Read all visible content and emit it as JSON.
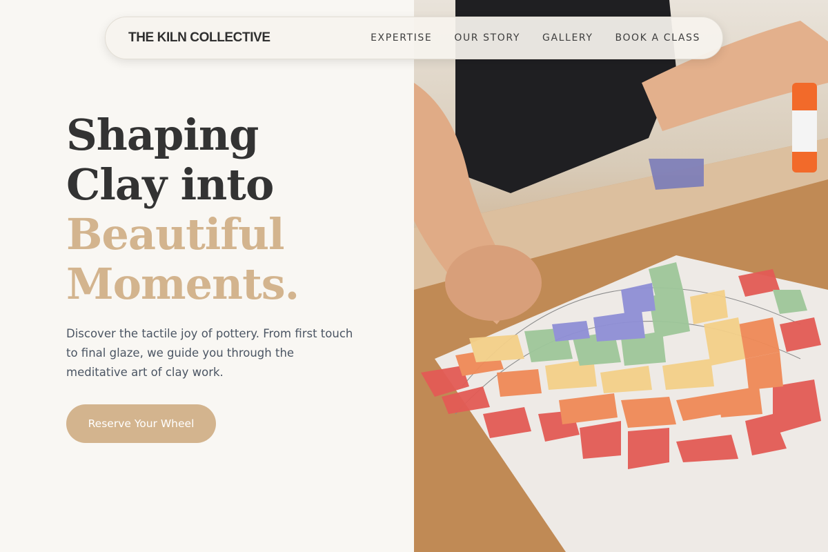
{
  "nav": {
    "brand": "THE KILN COLLECTIVE",
    "links": [
      {
        "label": "EXPERTISE"
      },
      {
        "label": "OUR STORY"
      },
      {
        "label": "GALLERY"
      },
      {
        "label": "BOOK A CLASS"
      }
    ]
  },
  "hero": {
    "headline_line1": "Shaping",
    "headline_line2": "Clay into",
    "headline_line3": "Beautiful",
    "headline_line4": "Moments.",
    "description": "Discover the tactile joy of pottery. From first touch to final glaze, we guide you through the meditative art of clay work.",
    "cta_label": "Reserve Your Wheel"
  },
  "colors": {
    "background": "#f9f7f3",
    "accent": "#d3b48e",
    "headline_dark": "#333333",
    "body_text": "#4b5563"
  }
}
